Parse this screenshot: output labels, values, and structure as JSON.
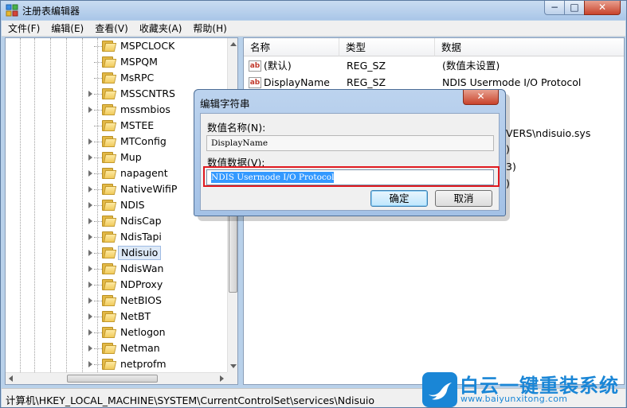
{
  "window": {
    "title": "注册表编辑器",
    "minimize": "−",
    "maximize": "□",
    "close": "✕"
  },
  "menu": [
    "文件(F)",
    "编辑(E)",
    "查看(V)",
    "收藏夹(A)",
    "帮助(H)"
  ],
  "tree": {
    "items": [
      "MSPCLOCK",
      "MSPQM",
      "MsRPC",
      "MSSCNTRS",
      "mssmbios",
      "MSTEE",
      "MTConfig",
      "Mup",
      "napagent",
      "NativeWifiP",
      "NDIS",
      "NdisCap",
      "NdisTapi",
      "Ndisuio",
      "NdisWan",
      "NDProxy",
      "NetBIOS",
      "NetBT",
      "Netlogon",
      "Netman",
      "netprofm"
    ],
    "selected": "Ndisuio"
  },
  "values": {
    "headers": {
      "name": "名称",
      "type": "类型",
      "data": "数据"
    },
    "rows": [
      {
        "name": "(默认)",
        "type": "REG_SZ",
        "data": "(数值未设置)",
        "icon": "ab"
      },
      {
        "name": "DisplayName",
        "type": "REG_SZ",
        "data": "NDIS Usermode I/O Protocol",
        "icon": "ab"
      }
    ],
    "partial": {
      "row3": ")",
      "row5": "VERS\\ndisuio.sys",
      "row6": ")",
      "row7": "3)",
      "row8": ")"
    }
  },
  "status": "计算机\\HKEY_LOCAL_MACHINE\\SYSTEM\\CurrentControlSet\\services\\Ndisuio",
  "dialog": {
    "title": "编辑字符串",
    "close": "✕",
    "name_label": "数值名称(N):",
    "name_value": "DisplayName",
    "data_label": "数值数据(V):",
    "data_value": "NDIS Usermode I/O Protocol",
    "ok": "确定",
    "cancel": "取消"
  },
  "watermark": {
    "title": "白云一键重装系统",
    "url": "www.baiyunxitong.com"
  },
  "colors": {
    "selection": "#3399ff",
    "highlight_outline": "#e0191f",
    "watermark": "#1a86d6"
  }
}
